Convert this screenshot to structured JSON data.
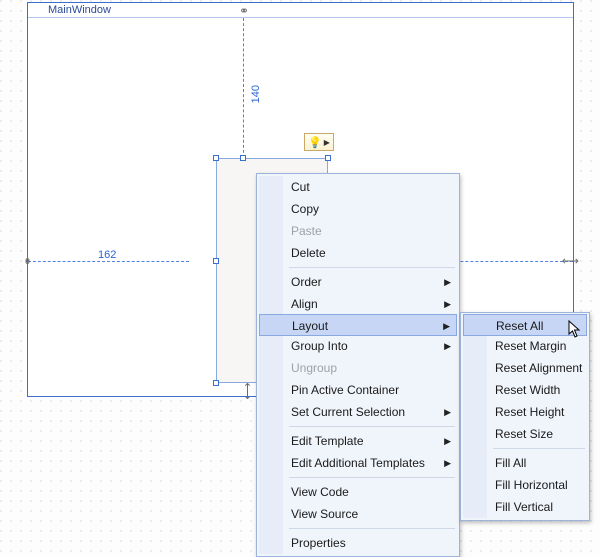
{
  "window": {
    "title": "MainWindow"
  },
  "dimensions": {
    "top": "140",
    "left": "162"
  },
  "menu_main": {
    "items": [
      {
        "label": "Cut",
        "kind": "item"
      },
      {
        "label": "Copy",
        "kind": "item"
      },
      {
        "label": "Paste",
        "kind": "disabled"
      },
      {
        "label": "Delete",
        "kind": "item"
      },
      {
        "kind": "sep"
      },
      {
        "label": "Order",
        "kind": "sub"
      },
      {
        "label": "Align",
        "kind": "sub"
      },
      {
        "label": "Layout",
        "kind": "sub",
        "highlight": true
      },
      {
        "label": "Group Into",
        "kind": "sub"
      },
      {
        "label": "Ungroup",
        "kind": "disabled"
      },
      {
        "label": "Pin Active Container",
        "kind": "item"
      },
      {
        "label": "Set Current Selection",
        "kind": "sub"
      },
      {
        "kind": "sep"
      },
      {
        "label": "Edit Template",
        "kind": "sub"
      },
      {
        "label": "Edit Additional Templates",
        "kind": "sub"
      },
      {
        "kind": "sep"
      },
      {
        "label": "View Code",
        "kind": "item"
      },
      {
        "label": "View Source",
        "kind": "item"
      },
      {
        "kind": "sep"
      },
      {
        "label": "Properties",
        "kind": "item"
      }
    ]
  },
  "menu_layout": {
    "items": [
      {
        "label": "Reset All",
        "kind": "item",
        "highlight": true
      },
      {
        "label": "Reset Margin",
        "kind": "item"
      },
      {
        "label": "Reset Alignment",
        "kind": "item"
      },
      {
        "label": "Reset Width",
        "kind": "item"
      },
      {
        "label": "Reset Height",
        "kind": "item"
      },
      {
        "label": "Reset Size",
        "kind": "item"
      },
      {
        "kind": "sep"
      },
      {
        "label": "Fill All",
        "kind": "item"
      },
      {
        "label": "Fill Horizontal",
        "kind": "item"
      },
      {
        "label": "Fill Vertical",
        "kind": "item"
      }
    ]
  }
}
